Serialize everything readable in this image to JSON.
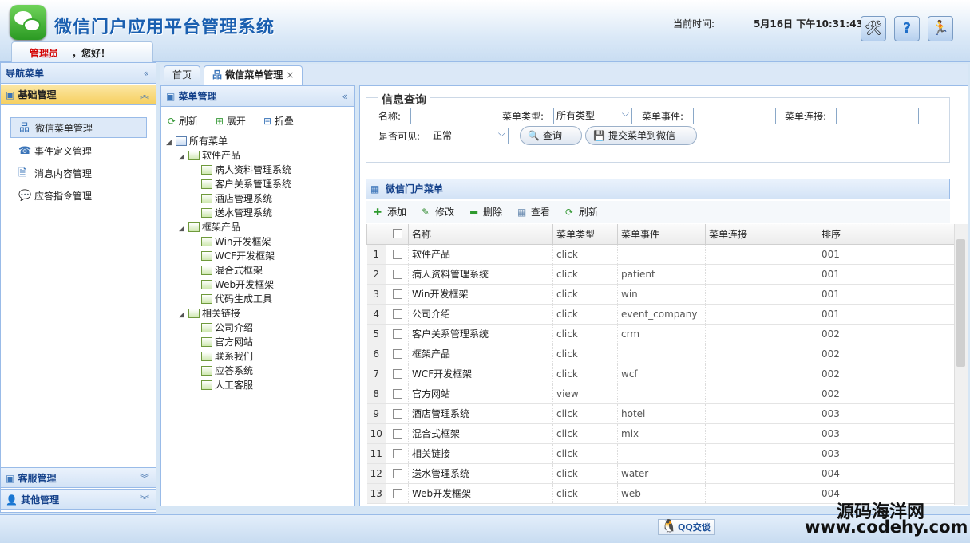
{
  "header": {
    "title": "微信门户应用平台管理系统",
    "role": "管理员",
    "greeting": "，您好！",
    "time_label": "当前时间:",
    "time_value": "5月16日 下午10:31:43"
  },
  "nav": {
    "title": "导航菜单",
    "sections": [
      "基础管理",
      "客服管理",
      "其他管理"
    ],
    "items": [
      {
        "label": "微信菜单管理",
        "icon": "sitemap-icon"
      },
      {
        "label": "事件定义管理",
        "icon": "phone-icon"
      },
      {
        "label": "消息内容管理",
        "icon": "document-icon"
      },
      {
        "label": "应答指令管理",
        "icon": "chat-icon"
      }
    ]
  },
  "tabs": [
    {
      "label": "首页"
    },
    {
      "label": "微信菜单管理",
      "close": "×"
    }
  ],
  "tree": {
    "title": "菜单管理",
    "toolbar": {
      "refresh": "刷新",
      "expand": "展开",
      "collapse": "折叠"
    },
    "root": "所有菜单",
    "groups": [
      {
        "label": "软件产品",
        "children": [
          "病人资料管理系统",
          "客户关系管理系统",
          "酒店管理系统",
          "送水管理系统"
        ]
      },
      {
        "label": "框架产品",
        "children": [
          "Win开发框架",
          "WCF开发框架",
          "混合式框架",
          "Web开发框架",
          "代码生成工具"
        ]
      },
      {
        "label": "相关链接",
        "children": [
          "公司介绍",
          "官方网站",
          "联系我们",
          "应答系统",
          "人工客服"
        ]
      }
    ]
  },
  "query": {
    "legend": "信息查询",
    "name_label": "名称:",
    "name_value": "",
    "type_label": "菜单类型:",
    "type_value": "所有类型",
    "event_label": "菜单事件:",
    "event_value": "",
    "link_label": "菜单连接:",
    "link_value": "",
    "visible_label": "是否可见:",
    "visible_value": "正常",
    "search_btn": "查询",
    "submit_btn": "提交菜单到微信"
  },
  "grid": {
    "title": "微信门户菜单",
    "toolbar": {
      "add": "添加",
      "edit": "修改",
      "delete": "删除",
      "view": "查看",
      "refresh": "刷新"
    },
    "columns": [
      "名称",
      "菜单类型",
      "菜单事件",
      "菜单连接",
      "排序"
    ],
    "rows": [
      {
        "n": "1",
        "name": "软件产品",
        "type": "click",
        "event": "",
        "link": "",
        "sort": "001"
      },
      {
        "n": "2",
        "name": "病人资料管理系统",
        "type": "click",
        "event": "patient",
        "link": "",
        "sort": "001"
      },
      {
        "n": "3",
        "name": "Win开发框架",
        "type": "click",
        "event": "win",
        "link": "",
        "sort": "001"
      },
      {
        "n": "4",
        "name": "公司介绍",
        "type": "click",
        "event": "event_company",
        "link": "",
        "sort": "001"
      },
      {
        "n": "5",
        "name": "客户关系管理系统",
        "type": "click",
        "event": "crm",
        "link": "",
        "sort": "002"
      },
      {
        "n": "6",
        "name": "框架产品",
        "type": "click",
        "event": "",
        "link": "",
        "sort": "002"
      },
      {
        "n": "7",
        "name": "WCF开发框架",
        "type": "click",
        "event": "wcf",
        "link": "",
        "sort": "002"
      },
      {
        "n": "8",
        "name": "官方网站",
        "type": "view",
        "event": "",
        "link": "",
        "sort": "002"
      },
      {
        "n": "9",
        "name": "酒店管理系统",
        "type": "click",
        "event": "hotel",
        "link": "",
        "sort": "003"
      },
      {
        "n": "10",
        "name": "混合式框架",
        "type": "click",
        "event": "mix",
        "link": "",
        "sort": "003"
      },
      {
        "n": "11",
        "name": "相关链接",
        "type": "click",
        "event": "",
        "link": "",
        "sort": "003"
      },
      {
        "n": "12",
        "name": "送水管理系统",
        "type": "click",
        "event": "water",
        "link": "",
        "sort": "004"
      },
      {
        "n": "13",
        "name": "Web开发框架",
        "type": "click",
        "event": "web",
        "link": "",
        "sort": "004"
      }
    ]
  },
  "footer": {
    "qq_label": "QQ交谈"
  },
  "watermark": {
    "line1": "源码海洋网",
    "line2": "www.codehy.com"
  },
  "colors": {
    "title_blue": "#1a5fb0",
    "role_red": "#d40000",
    "border": "#99bbe8",
    "active_section": "#f8d779"
  }
}
